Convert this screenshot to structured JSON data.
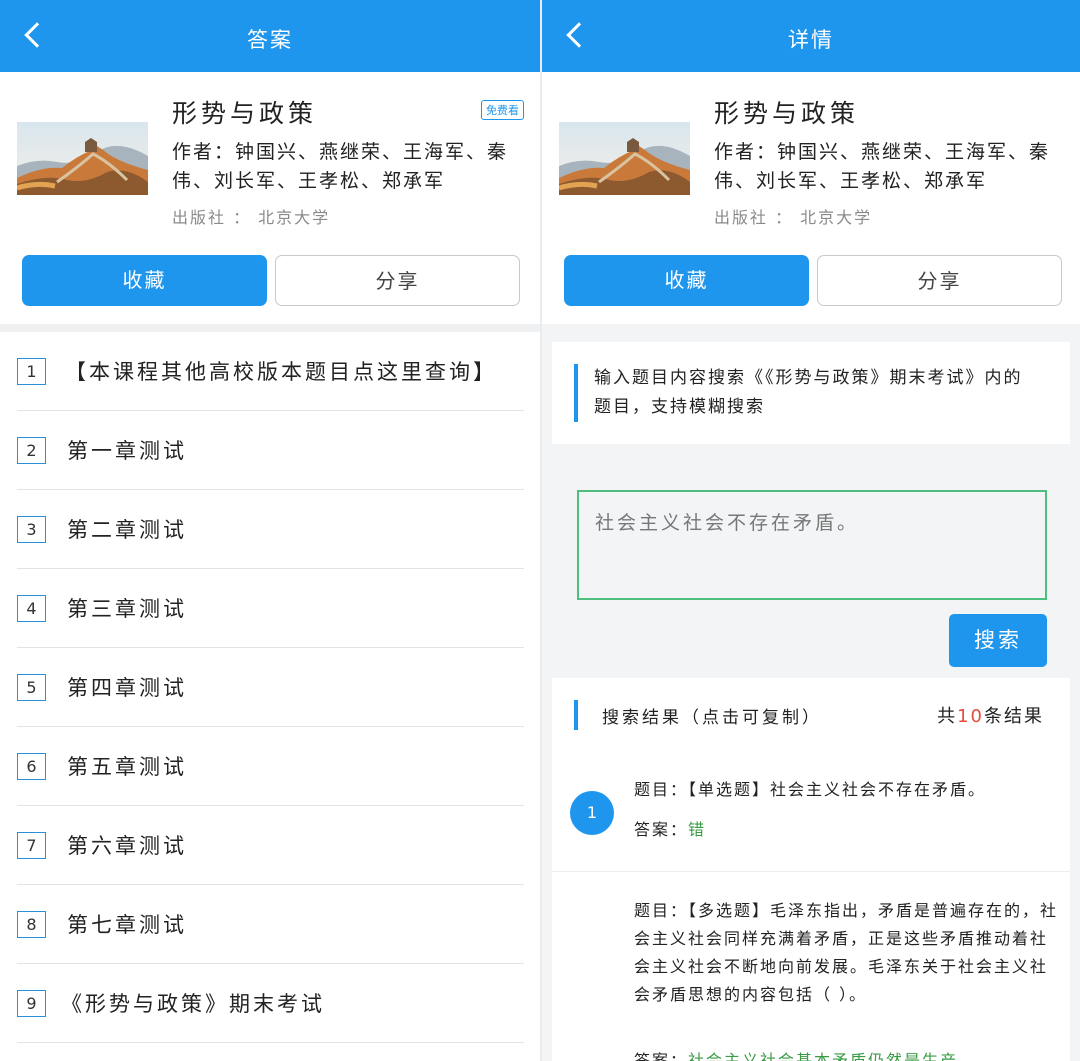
{
  "left": {
    "header": {
      "title": "答案"
    },
    "book": {
      "title": "形势与政策",
      "badge": "免费看",
      "authors": "作者：钟国兴、燕继荣、王海军、秦伟、刘长军、王孝松、郑承军",
      "publisher": "出版社 ： 北京大学"
    },
    "buttons": {
      "favorite": "收藏",
      "share": "分享"
    },
    "chapters": [
      {
        "num": "1",
        "label": "【本课程其他高校版本题目点这里查询】"
      },
      {
        "num": "2",
        "label": "第一章测试"
      },
      {
        "num": "3",
        "label": "第二章测试"
      },
      {
        "num": "4",
        "label": "第三章测试"
      },
      {
        "num": "5",
        "label": "第四章测试"
      },
      {
        "num": "6",
        "label": "第五章测试"
      },
      {
        "num": "7",
        "label": "第六章测试"
      },
      {
        "num": "8",
        "label": "第七章测试"
      },
      {
        "num": "9",
        "label": "《形势与政策》期末考试"
      }
    ]
  },
  "right": {
    "header": {
      "title": "详情"
    },
    "book": {
      "title": "形势与政策",
      "authors": "作者：钟国兴、燕继荣、王海军、秦伟、刘长军、王孝松、郑承军",
      "publisher": "出版社 ： 北京大学"
    },
    "buttons": {
      "favorite": "收藏",
      "share": "分享"
    },
    "search": {
      "hint": "输入题目内容搜索《《形势与政策》期末考试》内的题目，支持模糊搜索",
      "query": "社会主义社会不存在矛盾。",
      "button": "搜索"
    },
    "results": {
      "title": "搜索结果（点击可复制）",
      "count_prefix": "共",
      "count": "10",
      "count_suffix": "条结果",
      "items": [
        {
          "index": "1",
          "question_label": "题目：",
          "question": "【单选题】社会主义社会不存在矛盾。",
          "answer_label": "答案：",
          "answer": "错"
        },
        {
          "question_label": "题目：",
          "question": "【多选题】毛泽东指出，矛盾是普遍存在的，社会主义社会同样充满着矛盾，正是这些矛盾推动着社会主义社会不断地向前发展。毛泽东关于社会主义社会矛盾思想的内容包括（ ）。",
          "answer_label": "答案：",
          "answer": "社会主义社会基本矛盾仍然是生产"
        }
      ]
    }
  },
  "colors": {
    "primary": "#1f96ee",
    "answer_green": "#3a9b45",
    "count_red": "#e74c3c",
    "search_border": "#4fbf7f"
  }
}
